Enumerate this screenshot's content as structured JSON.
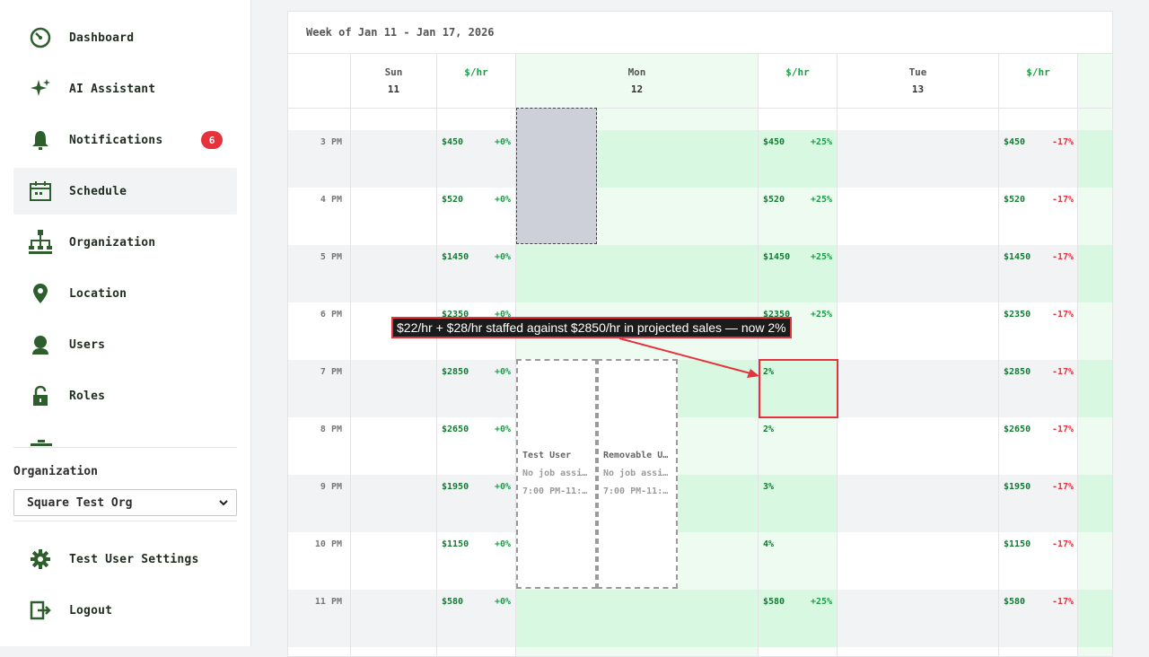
{
  "sidebar": {
    "items": [
      {
        "label": "Dashboard",
        "icon": "dashboard-icon"
      },
      {
        "label": "AI Assistant",
        "icon": "sparkle-icon"
      },
      {
        "label": "Notifications",
        "icon": "bell-icon",
        "badge": "6"
      },
      {
        "label": "Schedule",
        "icon": "calendar-icon",
        "active": true
      },
      {
        "label": "Organization",
        "icon": "org-chart-icon"
      },
      {
        "label": "Location",
        "icon": "location-pin-icon"
      },
      {
        "label": "Users",
        "icon": "user-icon"
      },
      {
        "label": "Roles",
        "icon": "lock-icon"
      }
    ],
    "organization_label": "Organization",
    "organization_value": "Square Test Org",
    "settings_label": "Test User Settings",
    "logout_label": "Logout"
  },
  "schedule": {
    "week_title": "Week of Jan 11 - Jan 17, 2026",
    "days": [
      {
        "name": "Sun",
        "num": "11",
        "rate_label": "$/hr"
      },
      {
        "name": "Mon",
        "num": "12",
        "rate_label": "$/hr"
      },
      {
        "name": "Tue",
        "num": "13",
        "rate_label": "$/hr"
      }
    ],
    "rows": [
      {
        "time": "3 PM",
        "sun": "$450",
        "sun_pct": "+0%",
        "mon": "$450",
        "mon_pct": "+25%",
        "tue": "$450",
        "tue_pct": "-17%"
      },
      {
        "time": "4 PM",
        "sun": "$520",
        "sun_pct": "+0%",
        "mon": "$520",
        "mon_pct": "+25%",
        "tue": "$520",
        "tue_pct": "-17%"
      },
      {
        "time": "5 PM",
        "sun": "$1450",
        "sun_pct": "+0%",
        "mon": "$1450",
        "mon_pct": "+25%",
        "tue": "$1450",
        "tue_pct": "-17%"
      },
      {
        "time": "6 PM",
        "sun": "$2350",
        "sun_pct": "+0%",
        "mon": "$2350",
        "mon_pct": "+25%",
        "tue": "$2350",
        "tue_pct": "-17%"
      },
      {
        "time": "7 PM",
        "sun": "$2850",
        "sun_pct": "+0%",
        "mon": "2%",
        "mon_pct": "",
        "tue": "$2850",
        "tue_pct": "-17%"
      },
      {
        "time": "8 PM",
        "sun": "$2650",
        "sun_pct": "+0%",
        "mon": "2%",
        "mon_pct": "",
        "tue": "$2650",
        "tue_pct": "-17%"
      },
      {
        "time": "9 PM",
        "sun": "$1950",
        "sun_pct": "+0%",
        "mon": "3%",
        "mon_pct": "",
        "tue": "$1950",
        "tue_pct": "-17%"
      },
      {
        "time": "10 PM",
        "sun": "$1150",
        "sun_pct": "+0%",
        "mon": "4%",
        "mon_pct": "",
        "tue": "$1150",
        "tue_pct": "-17%"
      },
      {
        "time": "11 PM",
        "sun": "$580",
        "sun_pct": "+0%",
        "mon": "$580",
        "mon_pct": "+25%",
        "tue": "$580",
        "tue_pct": "-17%"
      }
    ],
    "shifts": [
      {
        "name": "Test User",
        "job": "No job assi…",
        "time": "7:00 PM-11:…"
      },
      {
        "name": "Removable U…",
        "job": "No job assi…",
        "time": "7:00 PM-11:…"
      }
    ]
  },
  "annotation": {
    "text": "$22/hr + $28/hr staffed against $2850/hr in projected sales — now 2%"
  },
  "colors": {
    "accent_green": "#1a9e45",
    "negative_red": "#e5323d",
    "icon_green": "#2e5e2e",
    "mon_tint": "#eefbf1",
    "mon_tint_strong": "#d9f8e2"
  }
}
